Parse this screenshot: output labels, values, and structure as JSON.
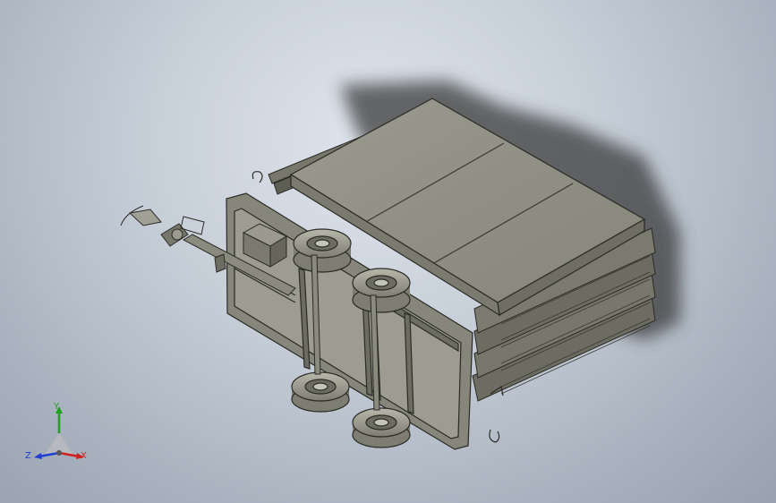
{
  "view": {
    "background_top": "#dfe5ec",
    "background_bottom": "#98a2af",
    "model_color": "#8e8e82",
    "model_dark": "#4a4a42",
    "edge_color": "#2b2b26"
  },
  "model": {
    "name": "trailer-assembly"
  },
  "triad": {
    "x_label": "X",
    "y_label": "Y",
    "z_label": "Z",
    "x_color": "#d11f1f",
    "y_color": "#1f9e1f",
    "z_color": "#1f3fd1"
  }
}
